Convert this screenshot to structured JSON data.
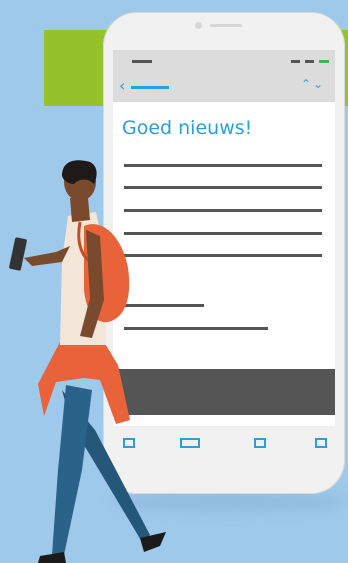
{
  "message": {
    "headline": "Goed nieuws!"
  },
  "icons": {
    "back": "chevron-left-icon",
    "navigate": "chevron-up-down-icon"
  },
  "colors": {
    "background": "#9ec9ea",
    "green_block": "#95c12b",
    "accent": "#2a9fd8",
    "status_green": "#3db54a",
    "backpack": "#e8633a"
  }
}
